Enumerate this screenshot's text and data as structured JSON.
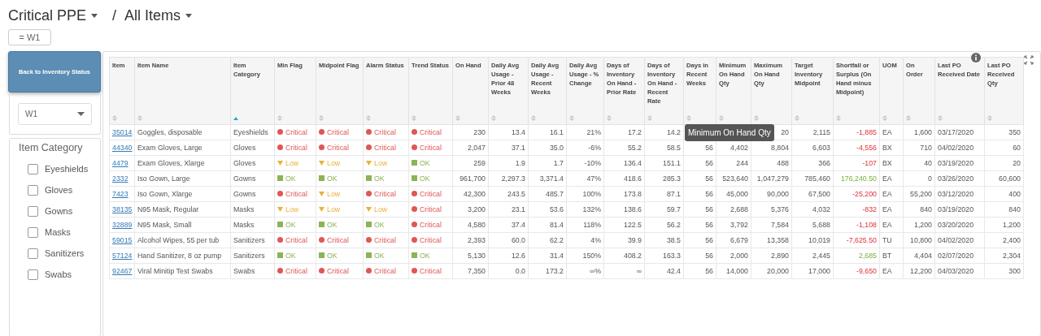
{
  "breadcrumb": [
    {
      "label": "Critical PPE"
    },
    {
      "label": "All Items"
    }
  ],
  "separator": "/",
  "filter_chip": "= W1",
  "back_button": "Back to Inventory Status",
  "warehouse_select": {
    "value": "W1"
  },
  "category_filter": {
    "title": "Item Category",
    "options": [
      {
        "label": "Eyeshields",
        "checked": false
      },
      {
        "label": "Gloves",
        "checked": false
      },
      {
        "label": "Gowns",
        "checked": false
      },
      {
        "label": "Masks",
        "checked": false
      },
      {
        "label": "Sanitizers",
        "checked": false
      },
      {
        "label": "Swabs",
        "checked": false
      }
    ]
  },
  "table": {
    "columns": [
      {
        "label": "Item",
        "sorted": false
      },
      {
        "label": "Item Name",
        "sorted": false
      },
      {
        "label": "Item Category",
        "sorted": true
      },
      {
        "label": "Min Flag",
        "sorted": false
      },
      {
        "label": "Midpoint Flag",
        "sorted": false
      },
      {
        "label": "Alarm Status",
        "sorted": false
      },
      {
        "label": "Trend Status",
        "sorted": false
      },
      {
        "label": "On Hand",
        "sorted": false
      },
      {
        "label": "Daily Avg Usage - Prior 48 Weeks",
        "sorted": false
      },
      {
        "label": "Daily Avg Usage - Recent Weeks",
        "sorted": false
      },
      {
        "label": "Daily Avg Usage - % Change",
        "sorted": false
      },
      {
        "label": "Days of Inventory On Hand - Prior Rate",
        "sorted": false
      },
      {
        "label": "Days of Inventory On Hand - Recent Rate",
        "sorted": false
      },
      {
        "label": "Days in Recent Weeks",
        "sorted": false
      },
      {
        "label": "Minimum On Hand Qty",
        "sorted": false
      },
      {
        "label": "Maximum On Hand Qty",
        "sorted": false
      },
      {
        "label": "Target Inventory Midpoint",
        "sorted": false
      },
      {
        "label": "Shortfall or Surplus (On Hand minus Midpoint)",
        "sorted": false
      },
      {
        "label": "UOM",
        "sorted": false
      },
      {
        "label": "On Order",
        "sorted": false
      },
      {
        "label": "Last PO Received Date",
        "sorted": false
      },
      {
        "label": "Last PO Received Qty",
        "sorted": false
      }
    ],
    "rows": [
      {
        "item": "35014",
        "name": "Goggles, disposable",
        "category": "Eyeshields",
        "flags": [
          {
            "kind": "critical",
            "label": "Critical"
          },
          {
            "kind": "critical",
            "label": "Critical"
          },
          {
            "kind": "critical",
            "label": "Critical"
          },
          {
            "kind": "critical",
            "label": "Critical"
          }
        ],
        "on_hand": "230",
        "usage_prior": "13.4",
        "usage_recent": "16.1",
        "usage_change": "21%",
        "days_prior": "17.2",
        "days_recent_rate": "14.2",
        "max_qty": "20",
        "target": "2,115",
        "shortfall": {
          "value": "-1,885",
          "kind": "deficit"
        },
        "uom": "EA",
        "on_order": "1,600",
        "last_po_date": "03/17/2020",
        "last_po_qty": "350"
      },
      {
        "item": "44340",
        "name": "Exam Gloves, Large",
        "category": "Gloves",
        "flags": [
          {
            "kind": "critical",
            "label": "Critical"
          },
          {
            "kind": "critical",
            "label": "Critical"
          },
          {
            "kind": "critical",
            "label": "Critical"
          },
          {
            "kind": "critical",
            "label": "Critical"
          }
        ],
        "on_hand": "2,047",
        "usage_prior": "37.1",
        "usage_recent": "35.0",
        "usage_change": "-6%",
        "days_prior": "55.2",
        "days_recent_rate": "58.5",
        "days_in_weeks": "56",
        "min_qty": "4,402",
        "max_qty": "8,804",
        "target": "6,603",
        "shortfall": {
          "value": "-4,556",
          "kind": "deficit"
        },
        "uom": "BX",
        "on_order": "710",
        "last_po_date": "04/02/2020",
        "last_po_qty": "60"
      },
      {
        "item": "4479",
        "name": "Exam Gloves, Xlarge",
        "category": "Gloves",
        "flags": [
          {
            "kind": "low",
            "label": "Low"
          },
          {
            "kind": "low",
            "label": "Low"
          },
          {
            "kind": "low",
            "label": "Low"
          },
          {
            "kind": "ok",
            "label": "OK"
          }
        ],
        "on_hand": "259",
        "usage_prior": "1.9",
        "usage_recent": "1.7",
        "usage_change": "-10%",
        "days_prior": "136.4",
        "days_recent_rate": "151.1",
        "days_in_weeks": "56",
        "min_qty": "244",
        "max_qty": "488",
        "target": "366",
        "shortfall": {
          "value": "-107",
          "kind": "deficit"
        },
        "uom": "BX",
        "on_order": "40",
        "last_po_date": "03/19/2020",
        "last_po_qty": "20"
      },
      {
        "item": "2332",
        "name": "Iso Gown, Large",
        "category": "Gowns",
        "flags": [
          {
            "kind": "ok",
            "label": "OK"
          },
          {
            "kind": "ok",
            "label": "OK"
          },
          {
            "kind": "ok",
            "label": "OK"
          },
          {
            "kind": "ok",
            "label": "OK"
          }
        ],
        "on_hand": "961,700",
        "usage_prior": "2,297.3",
        "usage_recent": "3,371.4",
        "usage_change": "47%",
        "days_prior": "418.6",
        "days_recent_rate": "285.3",
        "days_in_weeks": "56",
        "min_qty": "523,640",
        "max_qty": "1,047,279",
        "target": "785,460",
        "shortfall": {
          "value": "176,240.50",
          "kind": "surplus"
        },
        "uom": "EA",
        "on_order": "0",
        "last_po_date": "03/26/2020",
        "last_po_qty": "60,600"
      },
      {
        "item": "7423",
        "name": "Iso Gown, Xlarge",
        "category": "Gowns",
        "flags": [
          {
            "kind": "critical",
            "label": "Critical"
          },
          {
            "kind": "low",
            "label": "Low"
          },
          {
            "kind": "critical",
            "label": "Critical"
          },
          {
            "kind": "critical",
            "label": "Critical"
          }
        ],
        "on_hand": "42,300",
        "usage_prior": "243.5",
        "usage_recent": "485.7",
        "usage_change": "100%",
        "days_prior": "173.8",
        "days_recent_rate": "87.1",
        "days_in_weeks": "56",
        "min_qty": "45,000",
        "max_qty": "90,000",
        "target": "67,500",
        "shortfall": {
          "value": "-25,200",
          "kind": "deficit"
        },
        "uom": "EA",
        "on_order": "55,200",
        "last_po_date": "03/12/2020",
        "last_po_qty": "400"
      },
      {
        "item": "38135",
        "name": "N95 Mask, Regular",
        "category": "Masks",
        "flags": [
          {
            "kind": "low",
            "label": "Low"
          },
          {
            "kind": "low",
            "label": "Low"
          },
          {
            "kind": "low",
            "label": "Low"
          },
          {
            "kind": "critical",
            "label": "Critical"
          }
        ],
        "on_hand": "3,200",
        "usage_prior": "23.1",
        "usage_recent": "53.6",
        "usage_change": "132%",
        "days_prior": "138.6",
        "days_recent_rate": "59.7",
        "days_in_weeks": "56",
        "min_qty": "2,688",
        "max_qty": "5,376",
        "target": "4,032",
        "shortfall": {
          "value": "-832",
          "kind": "deficit"
        },
        "uom": "EA",
        "on_order": "840",
        "last_po_date": "03/19/2020",
        "last_po_qty": "840"
      },
      {
        "item": "32889",
        "name": "N95 Mask, Small",
        "category": "Masks",
        "flags": [
          {
            "kind": "ok",
            "label": "OK"
          },
          {
            "kind": "ok",
            "label": "OK"
          },
          {
            "kind": "ok",
            "label": "OK"
          },
          {
            "kind": "critical",
            "label": "Critical"
          }
        ],
        "on_hand": "4,580",
        "usage_prior": "37.4",
        "usage_recent": "81.4",
        "usage_change": "118%",
        "days_prior": "122.5",
        "days_recent_rate": "56.2",
        "days_in_weeks": "56",
        "min_qty": "3,792",
        "max_qty": "7,584",
        "target": "5,688",
        "shortfall": {
          "value": "-1,108",
          "kind": "deficit"
        },
        "uom": "EA",
        "on_order": "1,200",
        "last_po_date": "03/20/2020",
        "last_po_qty": "1,200"
      },
      {
        "item": "59015",
        "name": "Alcohol Wipes, 55 per tub",
        "category": "Sanitizers",
        "flags": [
          {
            "kind": "critical",
            "label": "Critical"
          },
          {
            "kind": "critical",
            "label": "Critical"
          },
          {
            "kind": "critical",
            "label": "Critical"
          },
          {
            "kind": "critical",
            "label": "Critical"
          }
        ],
        "on_hand": "2,393",
        "usage_prior": "60.0",
        "usage_recent": "62.2",
        "usage_change": "4%",
        "days_prior": "39.9",
        "days_recent_rate": "38.5",
        "days_in_weeks": "56",
        "min_qty": "6,679",
        "max_qty": "13,358",
        "target": "10,019",
        "shortfall": {
          "value": "-7,625.50",
          "kind": "deficit"
        },
        "uom": "TU",
        "on_order": "10,800",
        "last_po_date": "04/02/2020",
        "last_po_qty": "2,400"
      },
      {
        "item": "57124",
        "name": "Hand Sanitizer, 8 oz pump",
        "category": "Sanitizers",
        "flags": [
          {
            "kind": "ok",
            "label": "OK"
          },
          {
            "kind": "ok",
            "label": "OK"
          },
          {
            "kind": "ok",
            "label": "OK"
          },
          {
            "kind": "ok",
            "label": "OK"
          }
        ],
        "on_hand": "5,130",
        "usage_prior": "12.6",
        "usage_recent": "31.4",
        "usage_change": "150%",
        "days_prior": "408.2",
        "days_recent_rate": "163.3",
        "days_in_weeks": "56",
        "min_qty": "2,000",
        "max_qty": "2,890",
        "target": "2,445",
        "shortfall": {
          "value": "2,685",
          "kind": "surplus"
        },
        "uom": "BT",
        "on_order": "4,404",
        "last_po_date": "02/07/2020",
        "last_po_qty": "2,304"
      },
      {
        "item": "92467",
        "name": "Viral Minitip Test Swabs",
        "category": "Swabs",
        "flags": [
          {
            "kind": "critical",
            "label": "Critical"
          },
          {
            "kind": "critical",
            "label": "Critical"
          },
          {
            "kind": "critical",
            "label": "Critical"
          },
          {
            "kind": "critical",
            "label": "Critical"
          }
        ],
        "on_hand": "7,350",
        "usage_prior": "0.0",
        "usage_recent": "173.2",
        "usage_change": "∞%",
        "days_prior": "∞",
        "days_recent_rate": "42.4",
        "days_in_weeks": "56",
        "min_qty": "14,000",
        "max_qty": "20,000",
        "target": "17,000",
        "shortfall": {
          "value": "-9,650",
          "kind": "deficit"
        },
        "uom": "EA",
        "on_order": "12,200",
        "last_po_date": "04/03/2020",
        "last_po_qty": "300"
      }
    ]
  },
  "tooltip": "Minimum On Hand Qty"
}
